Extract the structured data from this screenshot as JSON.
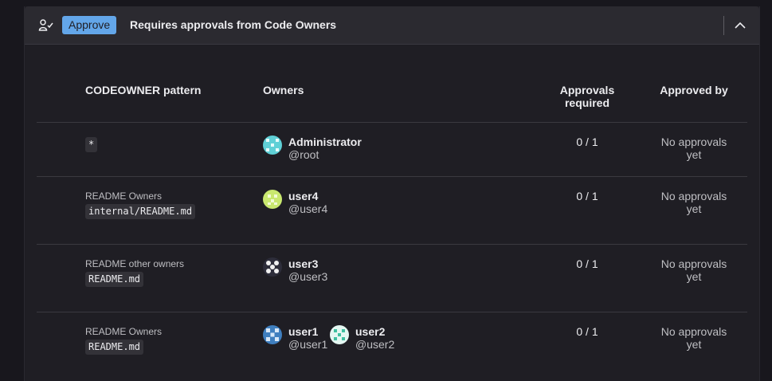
{
  "header": {
    "badge": "Approve",
    "title": "Requires approvals from Code Owners"
  },
  "columns": {
    "pattern": "CODEOWNER pattern",
    "owners": "Owners",
    "approvals_line1": "Approvals",
    "approvals_line2": "required",
    "approved_by": "Approved by"
  },
  "rows": [
    {
      "section": "",
      "pattern": "*",
      "owners": [
        {
          "name": "Administrator",
          "username": "@root",
          "avatar_color": "#5fd0d6"
        }
      ],
      "approvals": "0 / 1",
      "approved_by_line1": "No approvals",
      "approved_by_line2": "yet"
    },
    {
      "section": "README Owners",
      "pattern": "internal/README.md",
      "owners": [
        {
          "name": "user4",
          "username": "@user4",
          "avatar_color": "#c9e86f"
        }
      ],
      "approvals": "0 / 1",
      "approved_by_line1": "No approvals",
      "approved_by_line2": "yet"
    },
    {
      "section": "README other owners",
      "pattern": "README.md",
      "owners": [
        {
          "name": "user3",
          "username": "@user3",
          "avatar_color": "#2d2d3a"
        }
      ],
      "approvals": "0 / 1",
      "approved_by_line1": "No approvals",
      "approved_by_line2": "yet"
    },
    {
      "section": "README Owners",
      "pattern": "README.md",
      "owners": [
        {
          "name": "user1",
          "username": "@user1",
          "avatar_color": "#3f7fbf"
        },
        {
          "name": "user2",
          "username": "@user2",
          "avatar_color": "#3fbfa0"
        }
      ],
      "approvals": "0 / 1",
      "approved_by_line1": "No approvals",
      "approved_by_line2": "yet"
    }
  ],
  "colors": {
    "badge_bg": "#63a6e9",
    "panel_bg": "#1f1e24",
    "header_bg": "#2b2a30"
  },
  "icons": {
    "header_icon": "approval-check-icon",
    "toggle": "chevron-up-icon"
  }
}
